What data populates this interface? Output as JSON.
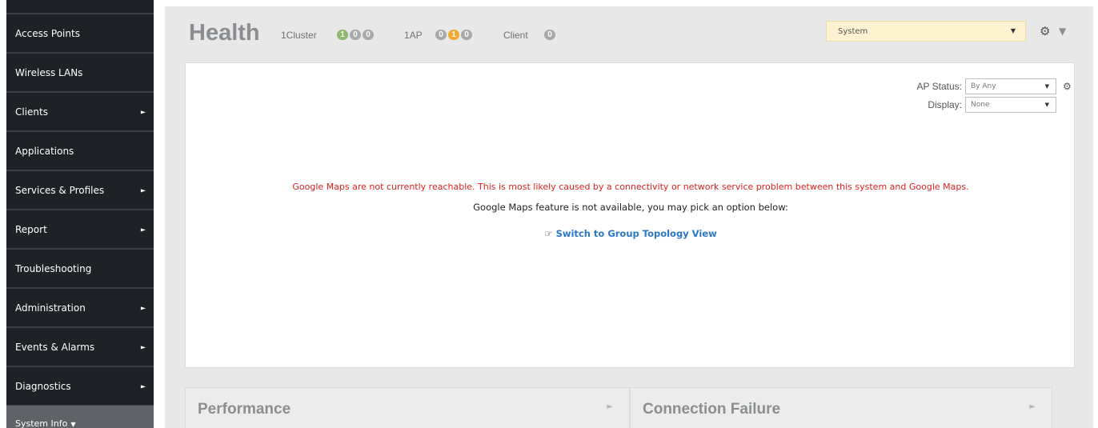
{
  "sidebar": {
    "items": [
      {
        "label": "Access Points",
        "has_arrow": false
      },
      {
        "label": "Wireless LANs",
        "has_arrow": false
      },
      {
        "label": "Clients",
        "has_arrow": true
      },
      {
        "label": "Applications",
        "has_arrow": false
      },
      {
        "label": "Services & Profiles",
        "has_arrow": true
      },
      {
        "label": "Report",
        "has_arrow": true
      },
      {
        "label": "Troubleshooting",
        "has_arrow": false
      },
      {
        "label": "Administration",
        "has_arrow": true
      },
      {
        "label": "Events & Alarms",
        "has_arrow": true
      },
      {
        "label": "Diagnostics",
        "has_arrow": true
      }
    ],
    "system_info": {
      "label": "System Info",
      "caret": "▼"
    },
    "arrow_glyph": "►"
  },
  "header": {
    "title": "Health",
    "cluster": {
      "label": "1Cluster",
      "badges": [
        {
          "value": "1",
          "color": "green"
        },
        {
          "value": "0",
          "color": "gray"
        },
        {
          "value": "0",
          "color": "gray"
        }
      ]
    },
    "ap": {
      "label": "1AP",
      "badges": [
        {
          "value": "0",
          "color": "gray"
        },
        {
          "value": "1",
          "color": "orange"
        },
        {
          "value": "0",
          "color": "gray"
        }
      ]
    },
    "client": {
      "label": "Client",
      "badges": [
        {
          "value": "0",
          "color": "gray"
        }
      ]
    },
    "system_select": {
      "value": "System",
      "caret": "▼"
    },
    "settings_icon": "gear-icon",
    "filter_icon": "funnel-icon"
  },
  "map_panel": {
    "ap_status": {
      "label": "AP Status:",
      "value": "By Any"
    },
    "display": {
      "label": "Display:",
      "value": "None"
    },
    "error_message": "Google Maps are not currently reachable. This is most likely caused by a connectivity or network service problem between this system and Google Maps.",
    "info_message": "Google Maps feature is not available, you may pick an option below:",
    "topology_link": "Switch to Group Topology View"
  },
  "bottom_panels": [
    {
      "title": "Performance"
    },
    {
      "title": "Connection Failure"
    }
  ],
  "colors": {
    "sidebar_bg": "#1e2125",
    "badge_green": "#8cb96a",
    "badge_orange": "#f0ab2f",
    "badge_gray": "#a7a9ab",
    "error_red": "#e0201f",
    "link_blue": "#2a77c9",
    "system_select_bg": "#fdf3d0"
  }
}
